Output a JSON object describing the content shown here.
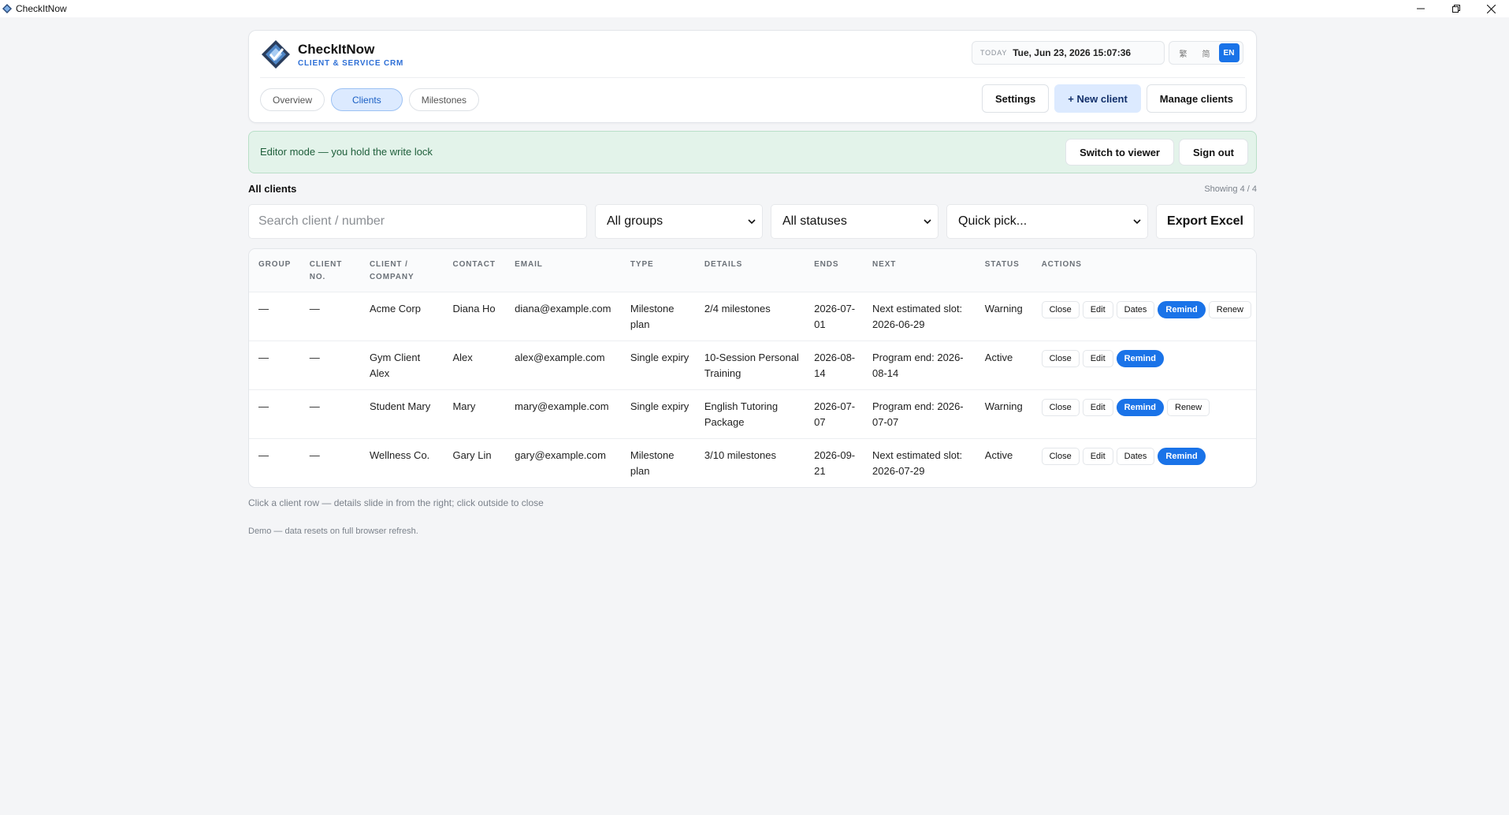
{
  "window": {
    "title": "CheckItNow"
  },
  "brand": {
    "name": "CheckItNow",
    "subtitle": "CLIENT & SERVICE CRM"
  },
  "today": {
    "label": "TODAY",
    "value": "Tue, Jun 23, 2026 15:07:36"
  },
  "languages": [
    {
      "label": "繁",
      "active": false
    },
    {
      "label": "简",
      "active": false
    },
    {
      "label": "EN",
      "active": true
    }
  ],
  "tabs": [
    {
      "label": "Overview",
      "active": false
    },
    {
      "label": "Clients",
      "active": true
    },
    {
      "label": "Milestones",
      "active": false
    }
  ],
  "header_actions": {
    "settings": "Settings",
    "new_client": "+ New client",
    "manage_clients": "Manage clients"
  },
  "banner": {
    "text": "Editor mode — you hold the write lock",
    "switch": "Switch to viewer",
    "signout": "Sign out"
  },
  "section": {
    "title": "All clients",
    "showing": "Showing 4 / 4"
  },
  "filters": {
    "search_placeholder": "Search client / number",
    "group": "All groups",
    "status": "All statuses",
    "quick": "Quick pick...",
    "export": "Export Excel"
  },
  "table": {
    "columns": [
      "GROUP",
      "CLIENT NO.",
      "CLIENT / COMPANY",
      "CONTACT",
      "EMAIL",
      "TYPE",
      "DETAILS",
      "ENDS",
      "NEXT",
      "STATUS",
      "ACTIONS"
    ],
    "rows": [
      {
        "group": "—",
        "client_no": "—",
        "company": "Acme Corp",
        "contact": "Diana Ho",
        "email": "diana@example.com",
        "type": "Milestone plan",
        "details": "2/4 milestones",
        "ends": "2026-07-01",
        "next": "Next estimated slot: 2026-06-29",
        "status": "Warning",
        "actions": [
          "Close",
          "Edit",
          "Dates",
          "Remind",
          "Renew"
        ]
      },
      {
        "group": "—",
        "client_no": "—",
        "company": "Gym Client Alex",
        "contact": "Alex",
        "email": "alex@example.com",
        "type": "Single expiry",
        "details": "10-Session Personal Training",
        "ends": "2026-08-14",
        "next": "Program end: 2026-08-14",
        "status": "Active",
        "actions": [
          "Close",
          "Edit",
          "Remind"
        ]
      },
      {
        "group": "—",
        "client_no": "—",
        "company": "Student Mary",
        "contact": "Mary",
        "email": "mary@example.com",
        "type": "Single expiry",
        "details": "English Tutoring Package",
        "ends": "2026-07-07",
        "next": "Program end: 2026-07-07",
        "status": "Warning",
        "actions": [
          "Close",
          "Edit",
          "Remind",
          "Renew"
        ]
      },
      {
        "group": "—",
        "client_no": "—",
        "company": "Wellness Co.",
        "contact": "Gary Lin",
        "email": "gary@example.com",
        "type": "Milestone plan",
        "details": "3/10 milestones",
        "ends": "2026-09-21",
        "next": "Next estimated slot: 2026-07-29",
        "status": "Active",
        "actions": [
          "Close",
          "Edit",
          "Dates",
          "Remind"
        ]
      }
    ]
  },
  "hint": "Click a client row — details slide in from the right; click outside to close",
  "footer": "Demo — data resets on full browser refresh.",
  "colors": {
    "accent": "#1a73e8",
    "banner_bg": "#e3f3ea",
    "active_tab_bg": "#dceaff"
  }
}
